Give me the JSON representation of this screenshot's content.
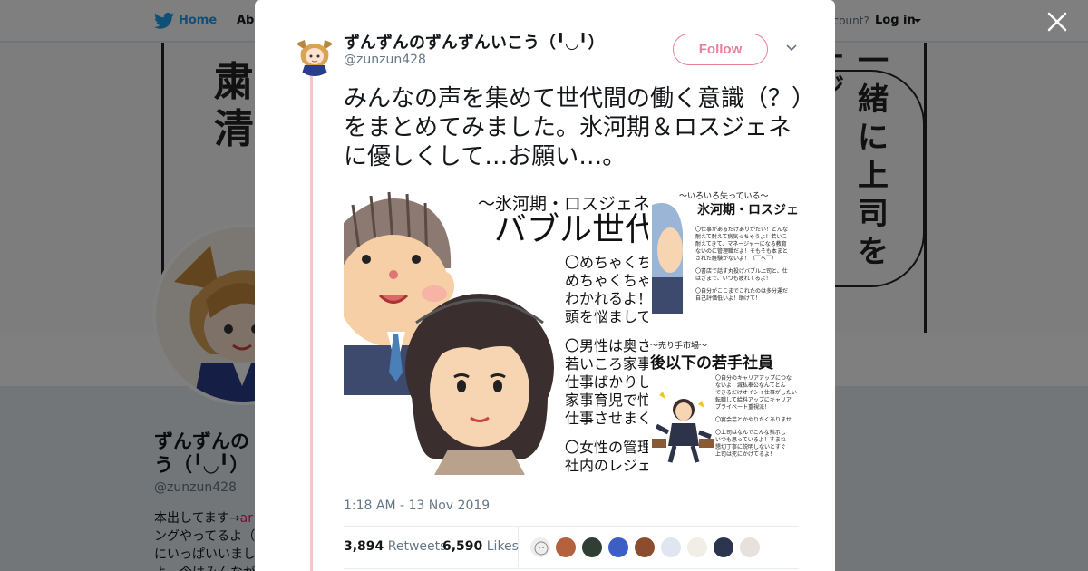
{
  "topbar": {
    "home_label": "Home",
    "about_label": "Abo",
    "have_account_label": "ccount?",
    "login_label": "Log in"
  },
  "banner": {
    "left_manga_text": "粛清！",
    "right_manga_text": "一緒に上司を",
    "right_manga_fragment": "ージ"
  },
  "profile": {
    "name_line1": "ずんずんの",
    "name_line2": "う（╹◡╹）",
    "handle": "@zunzun428",
    "bio_line1": "本出してます→",
    "bio_link": "ar",
    "bio_line2": "ングやってるよ（",
    "bio_line3": "にいっぱいいまし",
    "bio_line4": "よ。今はみんなが"
  },
  "tweet": {
    "author_name": "ずんずんのずんずんいこう（╹◡╹）",
    "author_handle": "@zunzun428",
    "follow_label": "Follow",
    "text": "みんなの声を集めて世代間の働く意識（？）をまとめてみました。氷河期＆ロスジェネに優しくして…お願い…。",
    "timestamp": "1:18 AM - 13 Nov 2019",
    "retweets_count": "3,894",
    "retweets_label": "Retweets",
    "likes_count": "6,590",
    "likes_label": "Likes"
  },
  "media": {
    "left": {
      "subtitle": "〜氷河期・ロスジェネが",
      "title": "バブル世代",
      "lines": [
        "〇めちゃくちゃ",
        "めちゃくちゃ仕",
        "わかれるよ！仕",
        "頭を悩ましてる",
        "",
        "〇男性は奥さん",
        "若いころ家事育",
        "仕事ばかりして",
        "家事育児で忙し",
        "仕事させまくる",
        "",
        "〇女性の管理職",
        "社内のレジェン"
      ]
    },
    "right_top": {
      "subtitle": "〜いろいろ失っている〜",
      "title": "氷河期・ロスジェネ",
      "lines": [
        "〇仕事があるだけありがたい！どんな",
        "耐えて耐えて病気っちゃうよ！若いこ",
        "耐えてきて、マネージャーになる教育",
        "ないのに管理職だよ！そもそも本まと",
        "された経験がないよ！（￣ヘ￣）",
        "",
        "〇書店で話す丸投げバブル上司と、仕",
        "はざまで、いつも疲れてるよ！",
        "",
        "〇自分がここまでこれたのは多分運だ",
        "自己評価低いよ！助けて！"
      ]
    },
    "right_bottom": {
      "subtitle": "〜売り手市場〜",
      "title": "後以下の若手社員",
      "lines": [
        "〇自分のキャリアアップにつな",
        "ないよ！滅私奉公なんてとん",
        "できるだけオイシイ仕事がしたい",
        "転職して給料アップにキャリア",
        "プライベート重視派！",
        "",
        "〇宴会芸とかやりたくありませ",
        "",
        "〇上司はなんでこんな指示し",
        "いつも思っているよ！すまね",
        "懇切丁寧に説明しないとすぐ",
        "上司は死にかけてるよ！"
      ]
    }
  },
  "colors": {
    "accent_pink": "#e8809a",
    "thread_line": "#f9c4cd",
    "twitter_blue": "#1da1f2"
  }
}
